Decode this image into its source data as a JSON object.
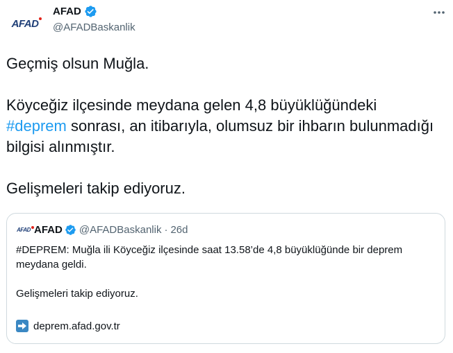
{
  "author": {
    "logo_text": "AFAD",
    "name": "AFAD",
    "handle": "@AFADBaskanlik"
  },
  "tweet": {
    "line1": "Geçmiş olsun Muğla.",
    "para2_start": "Köyceğiz ilçesinde meydana gelen 4,8 büyüklüğündeki",
    "hashtag": "#deprem",
    "para2_end": " sonrası, an itibarıyla, olumsuz bir ihbarın bulunmadığı bilgisi alınmıştır.",
    "line3": "Gelişmeleri takip ediyoruz."
  },
  "quoted": {
    "logo_text": "AFAD",
    "name": "AFAD",
    "handle": "@AFADBaskanlik",
    "separator": "·",
    "time": "26d",
    "text1": "#DEPREM: Muğla ili Köyceğiz ilçesinde saat 13.58’de 4,8 büyüklüğünde bir deprem meydana geldi.",
    "text2": "Gelişmeleri takip ediyoruz.",
    "link_text": "deprem.afad.gov.tr"
  },
  "colors": {
    "text": "#0f1419",
    "secondary": "#536471",
    "accent": "#1d9bf0",
    "border": "#cfd9de",
    "logo_blue": "#1f3f77",
    "logo_red": "#e2231a"
  },
  "icons": {
    "verified": "verified-badge-icon",
    "more": "more-horizontal-icon",
    "link": "right-arrow-icon"
  }
}
